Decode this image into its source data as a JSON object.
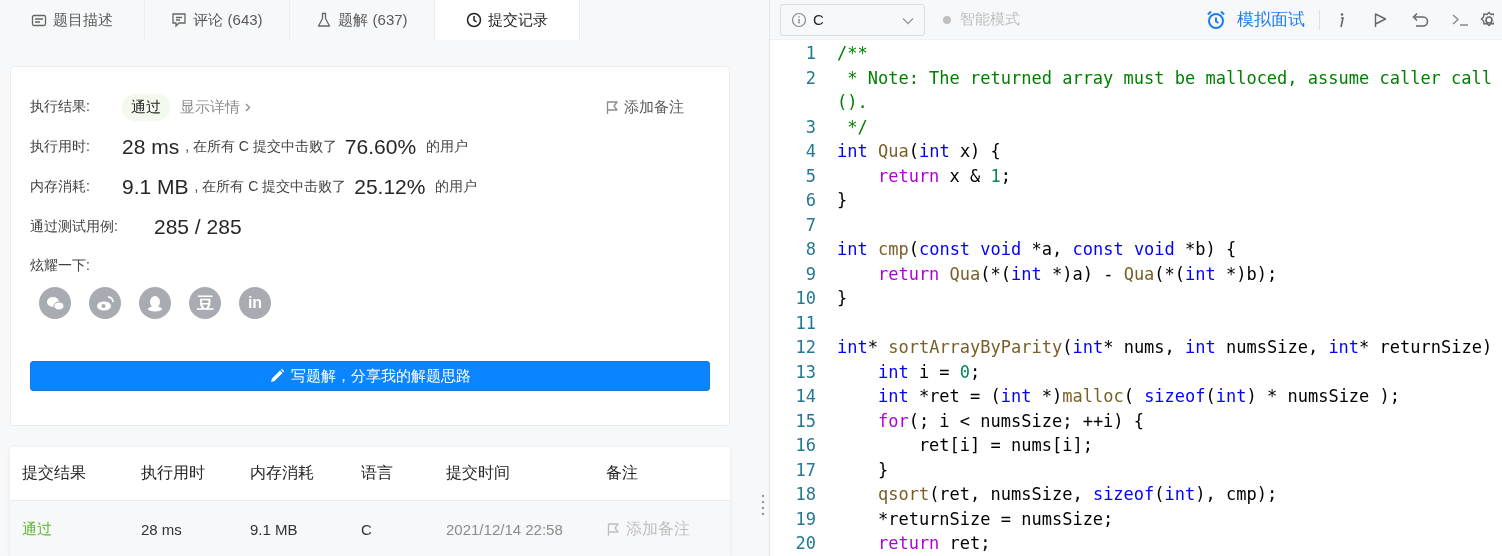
{
  "tabs": [
    {
      "kind": "description",
      "label": "题目描述",
      "selected": false
    },
    {
      "kind": "comments",
      "label": "评论 (643)",
      "selected": false
    },
    {
      "kind": "solutions",
      "label": "题解 (637)",
      "selected": false
    },
    {
      "kind": "submissions",
      "label": "提交记录",
      "selected": true
    }
  ],
  "editor_toolbar": {
    "language": "C",
    "smart_mode": {
      "label": "智能模式",
      "on": false
    },
    "mock_interview": "模拟面试"
  },
  "result": {
    "status_label": "执行结果:",
    "status": "通过",
    "details_link": "显示详情",
    "note_button": "添加备注",
    "stats": [
      {
        "label": "执行用时:",
        "value": "28 ms",
        "text": ", 在所有 C 提交中击败了",
        "percent": "76.60%",
        "suffix": "的用户"
      },
      {
        "label": "内存消耗:",
        "value": "9.1 MB",
        "text": ", 在所有 C 提交中击败了",
        "percent": "25.12%",
        "suffix": "的用户"
      }
    ],
    "cases": {
      "label": "通过测试用例:",
      "value": "285 / 285"
    },
    "share": {
      "label": "炫耀一下:",
      "buttons": [
        {
          "kind": "wechat"
        },
        {
          "kind": "weibo"
        },
        {
          "kind": "qq"
        },
        {
          "kind": "douban",
          "glyph": "豆"
        },
        {
          "kind": "linkedin",
          "glyph": "in"
        }
      ]
    },
    "write_button": "写题解，分享我的解题思路"
  },
  "table": {
    "columns": [
      "提交结果",
      "执行用时",
      "内存消耗",
      "语言",
      "提交时间",
      "备注"
    ],
    "rows": [
      {
        "kind": "accepted",
        "result": "通过",
        "time": "28 ms",
        "memory": "9.1 MB",
        "language": "C",
        "submitted": "2021/12/14 22:58",
        "note": "添加备注"
      }
    ]
  },
  "code": [
    {
      "number": "1",
      "tokens": [
        {
          "kind": "comment",
          "text": "/**"
        }
      ]
    },
    {
      "number": "2",
      "tokens": [
        {
          "kind": "comment",
          "text": " * Note: The returned array must be malloced, assume caller call"
        }
      ],
      "wrap": "()."
    },
    {
      "number": "3",
      "tokens": [
        {
          "kind": "comment",
          "text": " */"
        }
      ]
    },
    {
      "number": "4",
      "tokens": [
        {
          "kind": "keyword",
          "text": "int"
        },
        {
          "kind": "function",
          "text": " Qua"
        },
        {
          "kind": "plain",
          "text": "("
        },
        {
          "kind": "keyword",
          "text": "int"
        },
        {
          "kind": "plain",
          "text": " x) {"
        }
      ]
    },
    {
      "number": "5",
      "tokens": [
        {
          "kind": "control",
          "text": "    return"
        },
        {
          "kind": "plain",
          "text": " x & "
        },
        {
          "kind": "number",
          "text": "1"
        },
        {
          "kind": "plain",
          "text": ";"
        }
      ]
    },
    {
      "number": "6",
      "tokens": [
        {
          "kind": "plain",
          "text": "}"
        }
      ]
    },
    {
      "number": "7"
    },
    {
      "number": "8",
      "tokens": [
        {
          "kind": "keyword",
          "text": "int"
        },
        {
          "kind": "function",
          "text": " cmp"
        },
        {
          "kind": "plain",
          "text": "("
        },
        {
          "kind": "keyword",
          "text": "const void"
        },
        {
          "kind": "plain",
          "text": " *a, "
        },
        {
          "kind": "keyword",
          "text": "const void"
        },
        {
          "kind": "plain",
          "text": " *b) {"
        }
      ]
    },
    {
      "number": "9",
      "tokens": [
        {
          "kind": "control",
          "text": "    return"
        },
        {
          "kind": "function",
          "text": " Qua"
        },
        {
          "kind": "plain",
          "text": "(*("
        },
        {
          "kind": "keyword",
          "text": "int"
        },
        {
          "kind": "plain",
          "text": " *)a) - "
        },
        {
          "kind": "function",
          "text": "Qua"
        },
        {
          "kind": "plain",
          "text": "(*("
        },
        {
          "kind": "keyword",
          "text": "int"
        },
        {
          "kind": "plain",
          "text": " *)b);"
        }
      ]
    },
    {
      "number": "10",
      "tokens": [
        {
          "kind": "plain",
          "text": "}"
        }
      ]
    },
    {
      "number": "11"
    },
    {
      "number": "12",
      "tokens": [
        {
          "kind": "keyword",
          "text": "int"
        },
        {
          "kind": "plain",
          "text": "* "
        },
        {
          "kind": "function",
          "text": "sortArrayByParity"
        },
        {
          "kind": "plain",
          "text": "("
        },
        {
          "kind": "keyword",
          "text": "int"
        },
        {
          "kind": "plain",
          "text": "* nums, "
        },
        {
          "kind": "keyword",
          "text": "int"
        },
        {
          "kind": "plain",
          "text": " numsSize, "
        },
        {
          "kind": "keyword",
          "text": "int"
        },
        {
          "kind": "plain",
          "text": "* returnSize)"
        }
      ]
    },
    {
      "number": "13",
      "tokens": [
        {
          "kind": "keyword",
          "text": "    int"
        },
        {
          "kind": "plain",
          "text": " i = "
        },
        {
          "kind": "number",
          "text": "0"
        },
        {
          "kind": "plain",
          "text": ";"
        }
      ]
    },
    {
      "number": "14",
      "tokens": [
        {
          "kind": "keyword",
          "text": "    int"
        },
        {
          "kind": "plain",
          "text": " *ret = ("
        },
        {
          "kind": "keyword",
          "text": "int"
        },
        {
          "kind": "plain",
          "text": " *)"
        },
        {
          "kind": "function",
          "text": "malloc"
        },
        {
          "kind": "plain",
          "text": "("
        },
        {
          "kind": "keyword",
          "text": " sizeof"
        },
        {
          "kind": "plain",
          "text": "("
        },
        {
          "kind": "keyword",
          "text": "int"
        },
        {
          "kind": "plain",
          "text": ") * numsSize );"
        }
      ]
    },
    {
      "number": "15",
      "tokens": [
        {
          "kind": "control",
          "text": "    for"
        },
        {
          "kind": "plain",
          "text": "(; i < numsSize; ++i) {"
        }
      ]
    },
    {
      "number": "16",
      "tokens": [
        {
          "kind": "plain",
          "text": "        ret[i] = nums[i];"
        }
      ]
    },
    {
      "number": "17",
      "tokens": [
        {
          "kind": "plain",
          "text": "    }"
        }
      ]
    },
    {
      "number": "18",
      "tokens": [
        {
          "kind": "function",
          "text": "    qsort"
        },
        {
          "kind": "plain",
          "text": "(ret, numsSize, "
        },
        {
          "kind": "keyword",
          "text": "sizeof"
        },
        {
          "kind": "plain",
          "text": "("
        },
        {
          "kind": "keyword",
          "text": "int"
        },
        {
          "kind": "plain",
          "text": "), cmp);"
        }
      ]
    },
    {
      "number": "19",
      "tokens": [
        {
          "kind": "plain",
          "text": "    *returnSize = numsSize;"
        }
      ]
    },
    {
      "number": "20",
      "tokens": [
        {
          "kind": "control",
          "text": "    return"
        },
        {
          "kind": "plain",
          "text": " ret;"
        }
      ]
    }
  ]
}
